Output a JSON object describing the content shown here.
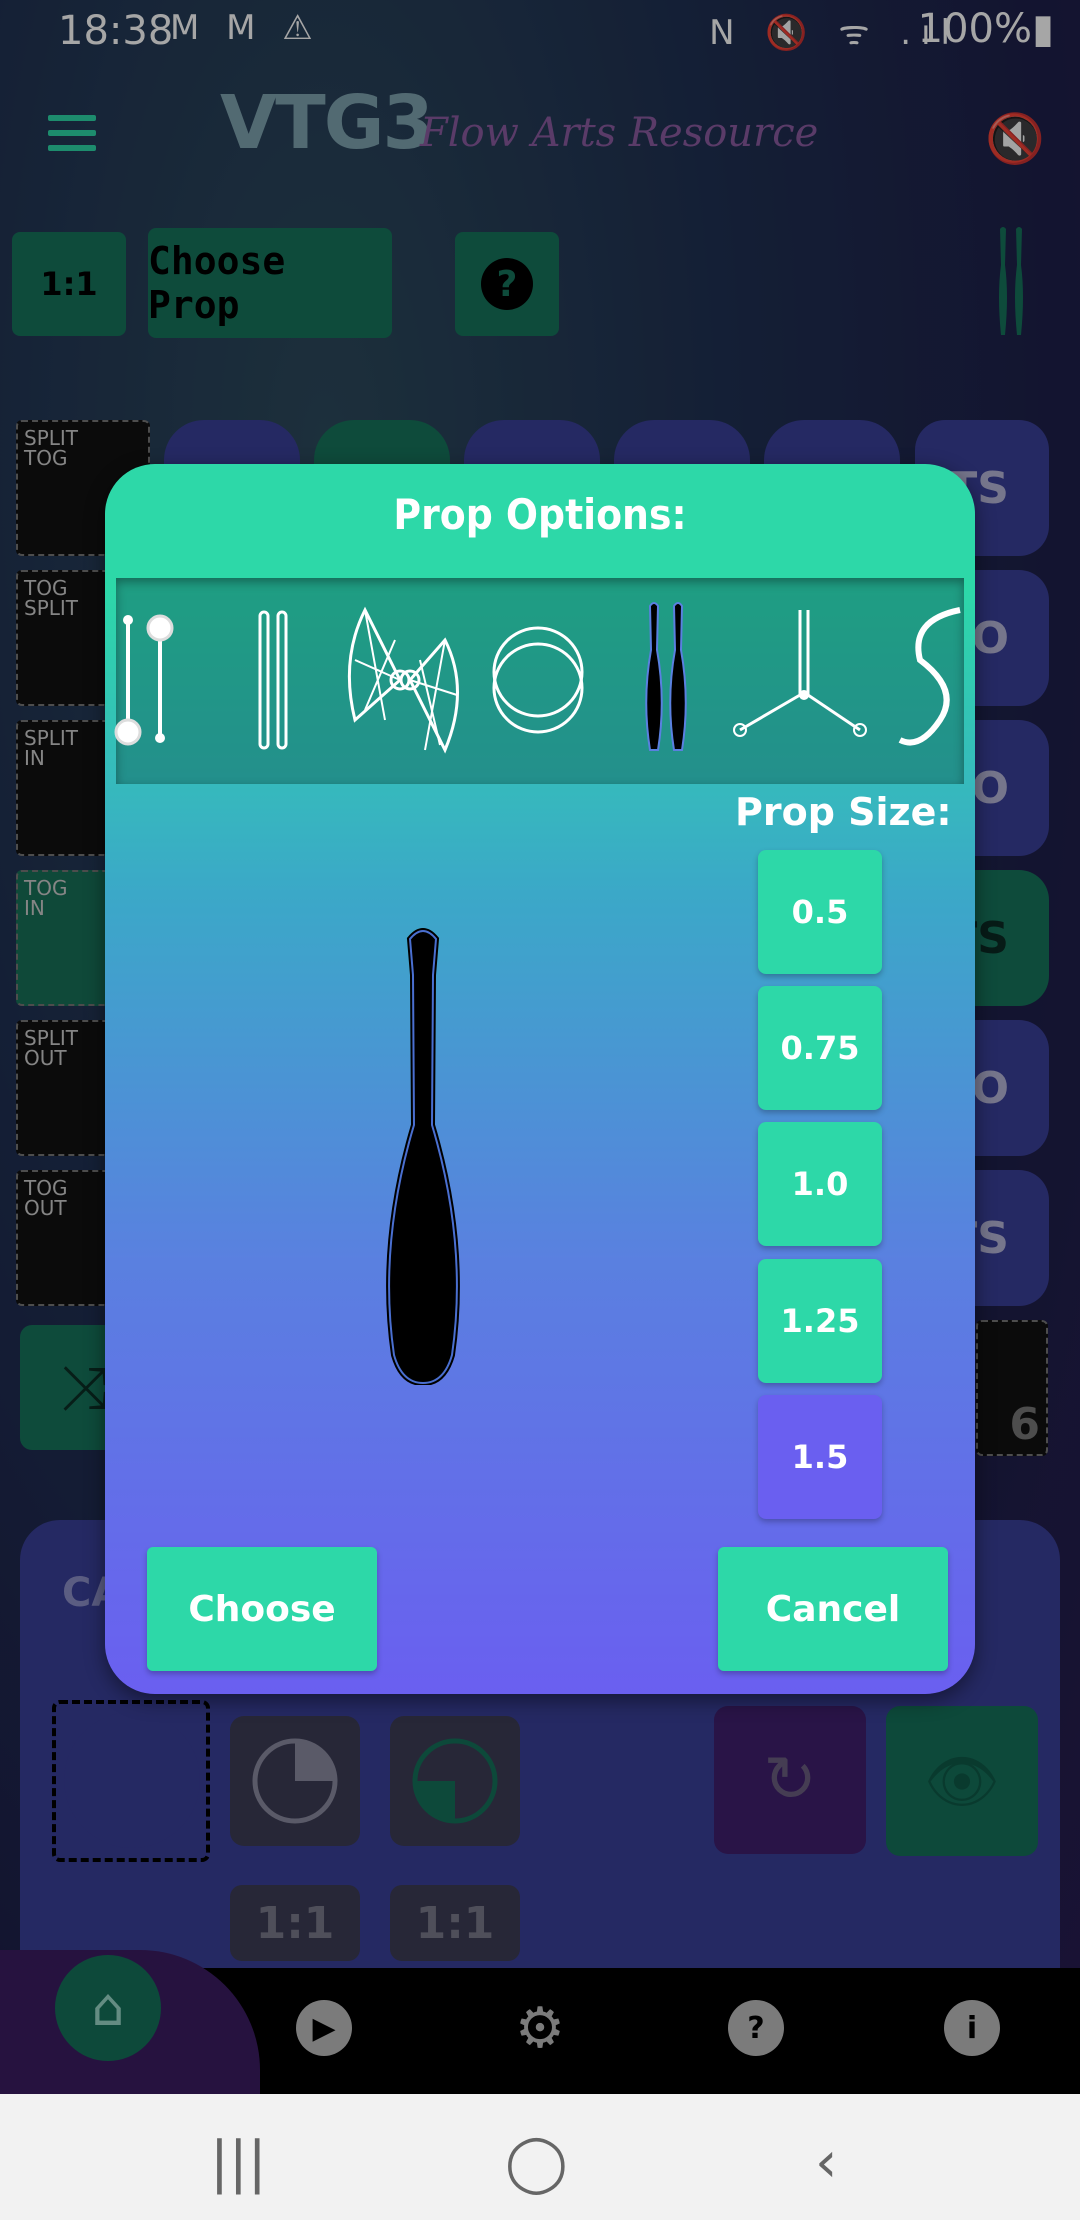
{
  "status_bar": {
    "time": "18:38",
    "left_icons": "M M ⚠",
    "right_icons": "N 🔇 ᯤ .ıl",
    "battery": "100%▮"
  },
  "header": {
    "logo": "VTG3",
    "logo_subtitle": "Flow Arts Resource"
  },
  "toolbar": {
    "ratio_label": "1:1",
    "choose_prop_label": "Choose Prop",
    "help_glyph": "?"
  },
  "side_tiles": [
    {
      "label": "SPLIT\nTOG"
    },
    {
      "label": "TOG\nSPLIT"
    },
    {
      "label": "SPLIT\nIN"
    },
    {
      "label": "TOG\nIN"
    },
    {
      "label": "SPLIT\nOUT"
    },
    {
      "label": "TOG\nOUT"
    }
  ],
  "right_pills": [
    "S/TS",
    "/SO",
    "/SO",
    "/TS",
    "/SO",
    "/TS"
  ],
  "tile_number": "6",
  "lower_panel": {
    "label": "CA",
    "ratio_1": "1:1",
    "ratio_2": "1:1"
  },
  "dialog": {
    "title": "Prop Options:",
    "props": [
      "poi-icon",
      "staff-pair-icon",
      "fan-icon",
      "hoop-icon",
      "club-icon",
      "buugeng-tri-icon",
      "buugeng-icon"
    ],
    "selected_prop": "club-icon",
    "size_label": "Prop Size:",
    "sizes": [
      "0.5",
      "0.75",
      "1.0",
      "1.25",
      "1.5"
    ],
    "selected_size": "1.5",
    "choose_label": "Choose",
    "cancel_label": "Cancel"
  },
  "colors": {
    "accent_green": "#2dd8a8",
    "dark_green": "#16735b",
    "purple": "#6a5ff0",
    "panel_blue": "#3a3f98"
  }
}
